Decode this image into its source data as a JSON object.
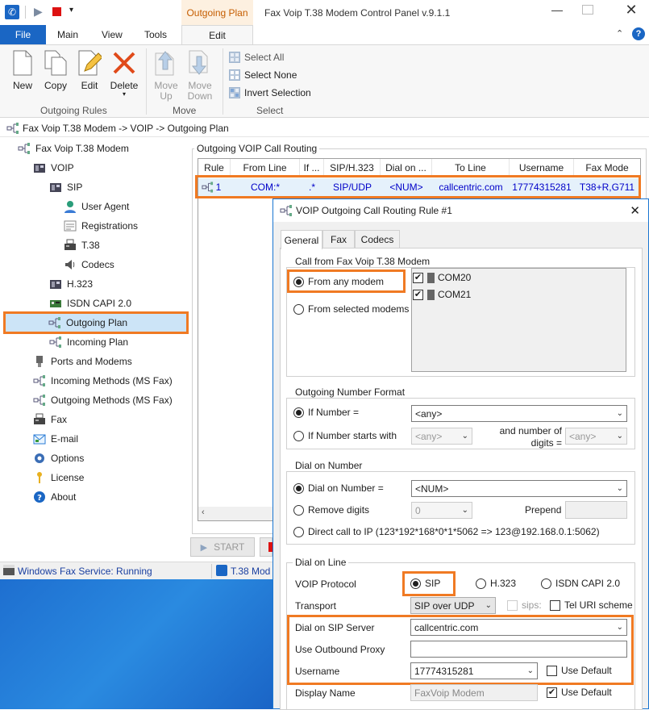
{
  "window": {
    "title": "Fax Voip T.38 Modem Control Panel v.9.1.1",
    "context_tab": "Outgoing Plan"
  },
  "menu_tabs": [
    "File",
    "Main",
    "View",
    "Tools",
    "Edit"
  ],
  "ribbon": {
    "new": "New",
    "copy": "Copy",
    "edit": "Edit",
    "delete": "Delete",
    "move_up": "Move Up",
    "move_down": "Move Down",
    "select_all": "Select All",
    "select_none": "Select None",
    "invert_selection": "Invert Selection",
    "group_rules": "Outgoing Rules",
    "group_move": "Move",
    "group_select": "Select"
  },
  "breadcrumb": "Fax Voip T.38 Modem -> VOIP -> Outgoing Plan",
  "tree": {
    "root": "Fax Voip T.38 Modem",
    "voip": "VOIP",
    "sip": "SIP",
    "user_agent": "User Agent",
    "registrations": "Registrations",
    "t38": "T.38",
    "codecs": "Codecs",
    "h323": "H.323",
    "isdn": "ISDN CAPI 2.0",
    "outgoing_plan": "Outgoing Plan",
    "incoming_plan": "Incoming Plan",
    "ports": "Ports and Modems",
    "incoming_methods": "Incoming Methods (MS Fax)",
    "outgoing_methods": "Outgoing Methods (MS Fax)",
    "fax": "Fax",
    "email": "E-mail",
    "options": "Options",
    "license": "License",
    "about": "About"
  },
  "routing": {
    "title": "Outgoing VOIP Call Routing",
    "columns": [
      "Rule",
      "From Line",
      "If ...",
      "SIP/H.323",
      "Dial on ...",
      "To Line",
      "Username",
      "Fax Mode"
    ],
    "row": [
      "1",
      "COM:*",
      ".*",
      "SIP/UDP",
      "<NUM>",
      "callcentric.com",
      "17774315281",
      "T38+R,G711"
    ],
    "start_button": "START"
  },
  "status": {
    "fax_service": "Windows Fax Service: Running",
    "t38": "T.38 Mod"
  },
  "dialog": {
    "title": "VOIP Outgoing Call Routing Rule #1",
    "tabs": [
      "General",
      "Fax",
      "Codecs"
    ],
    "call_from": {
      "legend": "Call from Fax Voip T.38 Modem",
      "any": "From any modem",
      "selected": "From selected modems",
      "modems": [
        "COM20",
        "COM21"
      ]
    },
    "number_format": {
      "legend": "Outgoing Number Format",
      "if_number": "If Number =",
      "if_number_value": "<any>",
      "starts_with": "If Number starts with",
      "starts_with_value": "<any>",
      "digits_label": "and number of digits =",
      "digits_value": "<any>"
    },
    "dial_number": {
      "legend": "Dial on Number",
      "dial_on": "Dial on Number =",
      "dial_value": "<NUM>",
      "remove": "Remove digits",
      "remove_value": "0",
      "prepend": "Prepend",
      "direct": "Direct call to IP (123*192*168*0*1*5062 => 123@192.168.0.1:5062)"
    },
    "dial_line": {
      "legend": "Dial on Line",
      "protocol_label": "VOIP Protocol",
      "sip": "SIP",
      "h323": "H.323",
      "isdn": "ISDN CAPI 2.0",
      "transport_label": "Transport",
      "transport_value": "SIP over UDP",
      "sips": "sips:",
      "tel_uri": "Tel URI scheme",
      "server_label": "Dial on SIP Server",
      "server_value": "callcentric.com",
      "proxy_label": "Use Outbound Proxy",
      "proxy_value": "",
      "username_label": "Username",
      "username_value": "17774315281",
      "use_default": "Use Default",
      "display_label": "Display Name",
      "display_value": "FaxVoip Modem",
      "use_default2": "Use Default"
    }
  }
}
